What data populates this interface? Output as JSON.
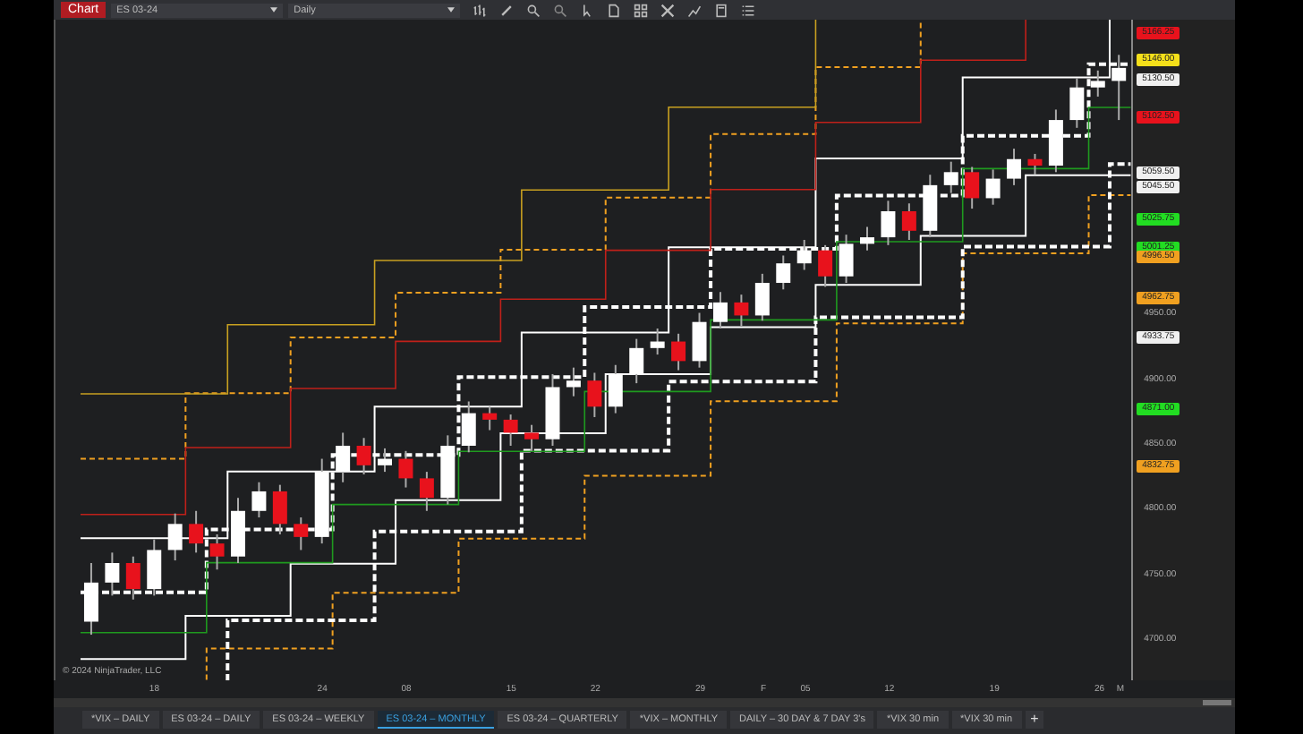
{
  "toolbar": {
    "title": "Chart",
    "instrument": "ES 03-24",
    "interval": "Daily"
  },
  "price_axis": [
    {
      "label": "5166.25",
      "kind": "marker",
      "color": "#e8121c"
    },
    {
      "label": "5146.00",
      "kind": "marker",
      "color": "#f5e01a"
    },
    {
      "label": "5130.50",
      "kind": "marker",
      "color": "#f0f0f0"
    },
    {
      "label": "5102.50",
      "kind": "marker",
      "color": "#e8121c"
    },
    {
      "label": "5059.50",
      "kind": "marker",
      "color": "#f0f0f0"
    },
    {
      "label": "5045.50",
      "kind": "marker",
      "color": "#f0f0f0"
    },
    {
      "label": "5025.75",
      "kind": "marker",
      "color": "#22dd22"
    },
    {
      "label": "5001.25",
      "kind": "marker",
      "color": "#22dd22"
    },
    {
      "label": "4996.50",
      "kind": "marker",
      "color": "#f0a020"
    },
    {
      "label": "4962.75",
      "kind": "marker",
      "color": "#f0a020"
    },
    {
      "label": "4933.75",
      "kind": "marker",
      "color": "#f0f0f0"
    },
    {
      "label": "4871.00",
      "kind": "marker",
      "color": "#22dd22"
    },
    {
      "label": "4832.75",
      "kind": "marker",
      "color": "#f0a020"
    }
  ],
  "chart": {
    "chart_data": {
      "type": "candlestick",
      "ylim": [
        4670,
        5177
      ],
      "yticks": [
        {
          "value": 4700,
          "label": "4700.00"
        },
        {
          "value": 4750,
          "label": "4750.00"
        },
        {
          "value": 4800,
          "label": "4800.00"
        },
        {
          "value": 4850,
          "label": "4850.00"
        },
        {
          "value": 4900,
          "label": "4900.00"
        },
        {
          "value": 4950,
          "label": "4950.00"
        }
      ],
      "categories": [
        null,
        null,
        null,
        "18",
        null,
        null,
        null,
        null,
        null,
        null,
        null,
        "24",
        null,
        null,
        null,
        "08",
        null,
        null,
        null,
        null,
        "15",
        null,
        null,
        null,
        "22",
        null,
        null,
        null,
        null,
        "29",
        null,
        null,
        "F",
        null,
        "05",
        null,
        null,
        null,
        "12",
        null,
        null,
        null,
        null,
        "19",
        null,
        null,
        null,
        null,
        "26",
        "M"
      ],
      "ohlc": [
        [
          4715,
          4760,
          4705,
          4745
        ],
        [
          4745,
          4768,
          4735,
          4760
        ],
        [
          4760,
          4765,
          4732,
          4740
        ],
        [
          4740,
          4778,
          4735,
          4770
        ],
        [
          4770,
          4798,
          4762,
          4790
        ],
        [
          4790,
          4800,
          4768,
          4775
        ],
        [
          4775,
          4782,
          4755,
          4765
        ],
        [
          4765,
          4810,
          4760,
          4800
        ],
        [
          4800,
          4822,
          4795,
          4815
        ],
        [
          4815,
          4820,
          4782,
          4790
        ],
        [
          4790,
          4795,
          4770,
          4780
        ],
        [
          4780,
          4840,
          4775,
          4830
        ],
        [
          4830,
          4860,
          4822,
          4850
        ],
        [
          4850,
          4856,
          4828,
          4835
        ],
        [
          4835,
          4848,
          4830,
          4840
        ],
        [
          4840,
          4846,
          4818,
          4825
        ],
        [
          4825,
          4830,
          4800,
          4810
        ],
        [
          4810,
          4858,
          4805,
          4850
        ],
        [
          4850,
          4884,
          4845,
          4875
        ],
        [
          4875,
          4880,
          4862,
          4870
        ],
        [
          4870,
          4874,
          4850,
          4860
        ],
        [
          4860,
          4866,
          4846,
          4855
        ],
        [
          4855,
          4905,
          4850,
          4895
        ],
        [
          4895,
          4910,
          4888,
          4900
        ],
        [
          4900,
          4906,
          4872,
          4880
        ],
        [
          4880,
          4912,
          4875,
          4905
        ],
        [
          4905,
          4932,
          4898,
          4925
        ],
        [
          4925,
          4940,
          4920,
          4930
        ],
        [
          4930,
          4936,
          4908,
          4915
        ],
        [
          4915,
          4952,
          4910,
          4945
        ],
        [
          4945,
          4968,
          4940,
          4960
        ],
        [
          4960,
          4966,
          4942,
          4950
        ],
        [
          4950,
          4982,
          4946,
          4975
        ],
        [
          4975,
          4996,
          4970,
          4990
        ],
        [
          4990,
          5008,
          4985,
          5000
        ],
        [
          5000,
          5004,
          4972,
          4980
        ],
        [
          4980,
          5012,
          4975,
          5005
        ],
        [
          5005,
          5018,
          5000,
          5010
        ],
        [
          5010,
          5038,
          5004,
          5030
        ],
        [
          5030,
          5036,
          5008,
          5015
        ],
        [
          5015,
          5058,
          5010,
          5050
        ],
        [
          5050,
          5068,
          5044,
          5060
        ],
        [
          5060,
          5064,
          5032,
          5040
        ],
        [
          5040,
          5062,
          5035,
          5055
        ],
        [
          5055,
          5078,
          5050,
          5070
        ],
        [
          5070,
          5074,
          5058,
          5065
        ],
        [
          5065,
          5108,
          5060,
          5100
        ],
        [
          5100,
          5132,
          5094,
          5125
        ],
        [
          5125,
          5138,
          5118,
          5130
        ],
        [
          5130,
          5150,
          5100,
          5140
        ]
      ]
    }
  },
  "copyright": "© 2024 NinjaTrader, LLC",
  "tabs": [
    {
      "label": "*VIX – DAILY",
      "selected": false
    },
    {
      "label": "ES 03-24 – DAILY",
      "selected": false
    },
    {
      "label": "ES 03-24 – WEEKLY",
      "selected": false
    },
    {
      "label": "ES 03-24 – MONTHLY",
      "selected": true
    },
    {
      "label": "ES 03-24 – QUARTERLY",
      "selected": false
    },
    {
      "label": "*VIX – MONTHLY",
      "selected": false
    },
    {
      "label": "DAILY – 30 DAY & 7 DAY 3's",
      "selected": false
    },
    {
      "label": "*VIX 30 min",
      "selected": false
    },
    {
      "label": "*VIX 30 min",
      "selected": false
    }
  ],
  "add_tab": "+"
}
